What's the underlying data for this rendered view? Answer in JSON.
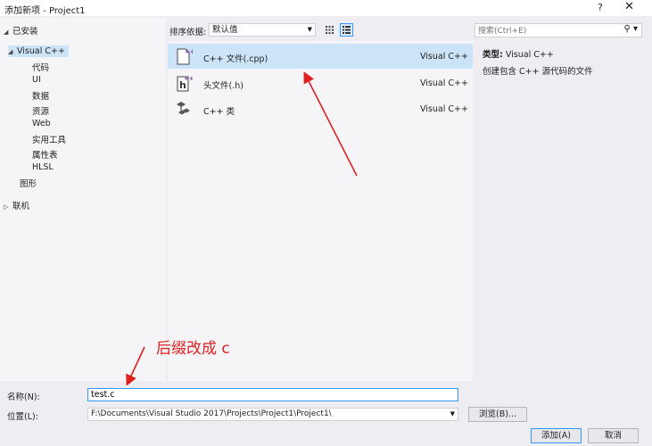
{
  "window": {
    "title": "添加新项 - Project1",
    "help": "?",
    "close": "✕"
  },
  "tree": {
    "installed": "已安装",
    "visual_cpp": "Visual C++",
    "children": [
      "代码",
      "UI",
      "数据",
      "资源",
      "Web",
      "实用工具",
      "属性表",
      "HLSL"
    ],
    "graphics": "图形",
    "online": "联机"
  },
  "sort": {
    "label": "排序依据:",
    "value": "默认值"
  },
  "search": {
    "placeholder": "搜索(Ctrl+E)"
  },
  "templates": [
    {
      "name": "C++ 文件(.cpp)",
      "lang": "Visual C++",
      "icon": "cpp-file-icon"
    },
    {
      "name": "头文件(.h)",
      "lang": "Visual C++",
      "icon": "header-file-icon"
    },
    {
      "name": "C++ 类",
      "lang": "Visual C++",
      "icon": "class-icon"
    }
  ],
  "details": {
    "type_key": "类型:",
    "type_value": "Visual C++",
    "description": "创建包含 C++ 源代码的文件"
  },
  "annotation": {
    "text": "后缀改成 c",
    "color": "#e02020"
  },
  "form": {
    "name_label": "名称(N):",
    "name_value": "test.c",
    "location_label": "位置(L):",
    "location_value": "F:\\Documents\\Visual Studio 2017\\Projects\\Project1\\Project1\\",
    "browse_label": "浏览(B)...",
    "add_label": "添加(A)",
    "cancel_label": "取消"
  },
  "colors": {
    "selection": "#cce4f7",
    "accent": "#3399ff"
  }
}
